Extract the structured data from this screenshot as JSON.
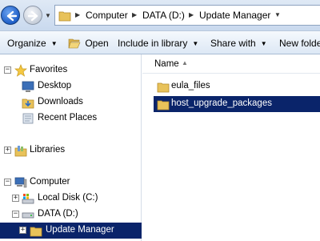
{
  "address_bar": {
    "breadcrumbs": [
      "Computer",
      "DATA (D:)",
      "Update Manager"
    ]
  },
  "toolbar": {
    "organize": "Organize",
    "open": "Open",
    "include_in_library": "Include in library",
    "share_with": "Share with",
    "new_folder": "New folder"
  },
  "nav": {
    "favorites": "Favorites",
    "desktop": "Desktop",
    "downloads": "Downloads",
    "recent_places": "Recent Places",
    "libraries": "Libraries",
    "computer": "Computer",
    "local_disk": "Local Disk (C:)",
    "data_drive": "DATA (D:)",
    "update_manager": "Update Manager"
  },
  "content": {
    "column_name": "Name",
    "files": [
      {
        "name": "eula_files",
        "selected": false
      },
      {
        "name": "host_upgrade_packages",
        "selected": true
      }
    ]
  },
  "colors": {
    "selection": "#0a246a",
    "chrome_top": "#dfe9f5",
    "folder": "#e8c25a"
  }
}
